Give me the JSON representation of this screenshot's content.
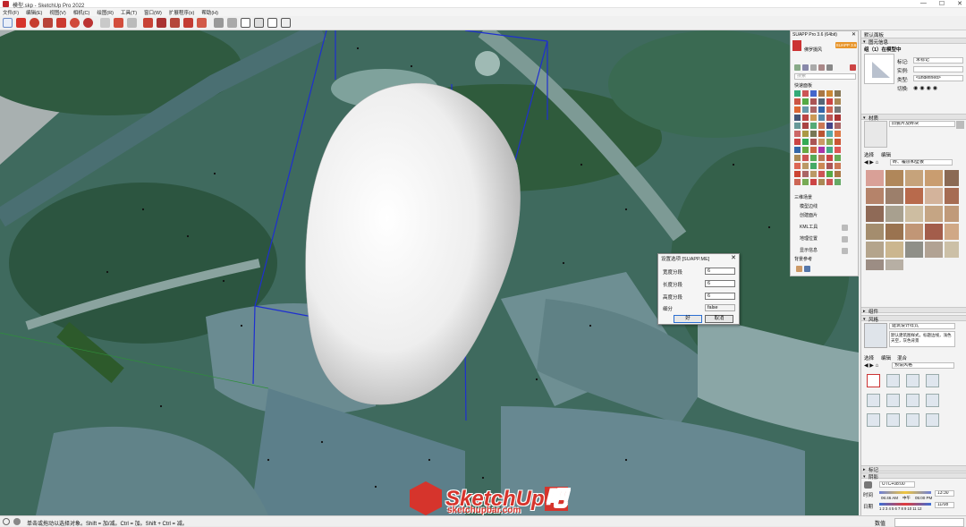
{
  "window": {
    "title": "模型.skp - SketchUp Pro 2022",
    "min": "—",
    "max": "☐",
    "close": "✕"
  },
  "menu": [
    "文件(F)",
    "编辑(E)",
    "视图(V)",
    "相机(C)",
    "绘图(R)",
    "工具(T)",
    "窗口(W)",
    "扩展程序(x)",
    "帮助(H)"
  ],
  "colors": {
    "accent": "#d6342c",
    "model_line": "#1e2fd0",
    "blob": "#f2f2f2"
  },
  "suapp": {
    "title": "SUAPP Pro 3.6 (64bit)",
    "badge": "SUAPP 3.6",
    "user": "佛罗摄风",
    "search_placeholder": "搜索",
    "section_label": "快速面板",
    "groups": [
      {
        "label": "三维场景"
      },
      {
        "label": "模型边线"
      },
      {
        "label": "创建面片"
      },
      {
        "label": "KML工具"
      },
      {
        "label": "地理位置"
      },
      {
        "label": "显示信息"
      },
      {
        "label": "背景参考"
      }
    ]
  },
  "dialog": {
    "title": "设置选项 [SUAPP.ME]",
    "rows": [
      {
        "label": "宽度分段",
        "value": "6"
      },
      {
        "label": "长度分段",
        "value": "6"
      },
      {
        "label": "高度分段",
        "value": "6"
      },
      {
        "label": "细分",
        "value": "false"
      }
    ],
    "ok": "好",
    "cancel": "取消"
  },
  "tray": {
    "header": "默认面板",
    "entity_info": {
      "title": "图元信息",
      "selected": "组（1）在模型中",
      "tag_label": "标记:",
      "tag_value": "未标记",
      "instance_label": "实例:",
      "type_label": "类型:",
      "type_value": "<undefined>",
      "toggle_label": "切换:"
    },
    "materials": {
      "title": "材质",
      "name": "旧瓷片及砖块",
      "tab_select": "选择",
      "tab_edit": "编辑",
      "dropdown": "砖、覆层和壁板"
    },
    "components": {
      "title": "组件"
    },
    "styles": {
      "title": "风格",
      "style_name": "建筑设计样式",
      "style_desc": "默认建筑图样式，标题边线，浅色天空，灰色背景",
      "tab_select": "选择",
      "tab_edit": "编辑",
      "tab_mix": "混合",
      "dropdown": "预设风格"
    },
    "tags": {
      "title": "标记"
    },
    "shadows": {
      "title": "阴影",
      "utc": "UTC+08:00",
      "time_label": "时间",
      "date_label": "日期",
      "time_start": "06:46 AM",
      "time_noon": "中午",
      "time_end": "05:00 PM",
      "time_value": "13:30",
      "months": "1 2 3 4 5 6 7 8 9 10 11 12",
      "date_value": "11/08"
    }
  },
  "status": {
    "message": "单击或拖动以选择对象。Shift = 加/减。Ctrl = 加。Shift + Ctrl = 减。",
    "measure_label": "数值"
  },
  "watermark": {
    "brand": "SketchUp",
    "brand_suffix": "吧",
    "site": "sketchupbar.com"
  }
}
